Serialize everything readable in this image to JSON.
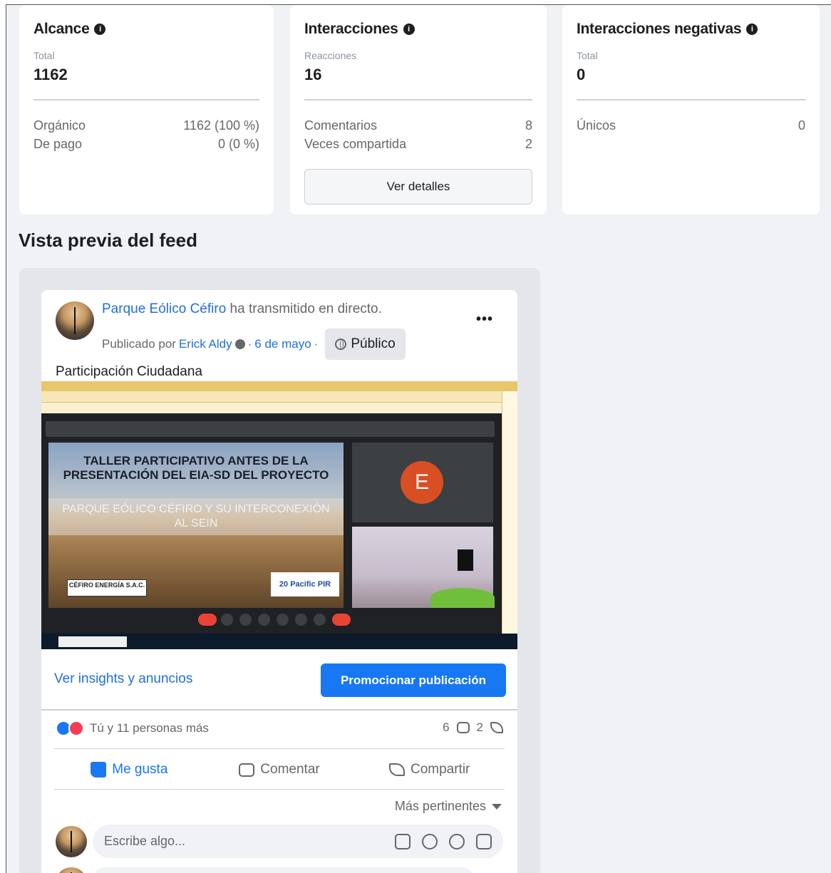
{
  "metrics": {
    "reach": {
      "title": "Alcance",
      "sub_label": "Total",
      "total": "1162",
      "rows": [
        {
          "label": "Orgánico",
          "value": "1162 (100 %)"
        },
        {
          "label": "De pago",
          "value": "0 (0 %)"
        }
      ]
    },
    "interactions": {
      "title": "Interacciones",
      "sub_label": "Reacciones",
      "total": "16",
      "rows": [
        {
          "label": "Comentarios",
          "value": "8"
        },
        {
          "label": "Veces compartida",
          "value": "2"
        }
      ],
      "details_button": "Ver detalles"
    },
    "negative": {
      "title": "Interacciones negativas",
      "sub_label": "Total",
      "total": "0",
      "rows": [
        {
          "label": "Únicos",
          "value": "0"
        }
      ]
    }
  },
  "feed_preview": {
    "section_title": "Vista previa del feed",
    "post": {
      "page_name": "Parque Eólico Céfiro",
      "action_text": "ha transmitido en directo.",
      "published_by_label": "Publicado por",
      "author": "Erick Aldy",
      "date": "6 de mayo",
      "audience": "Público",
      "text": "Participación Ciudadana",
      "media": {
        "slide_title": "TALLER PARTICIPATIVO ANTES DE LA PRESENTACIÓN DEL EIA-SD DEL PROYECTO",
        "slide_subtitle": "PARQUE EÓLICO CÉFIRO Y SU INTERCONEXIÓN AL SEIN",
        "logo_left": "CÉFIRO ENERGÍA S.A.C.",
        "logo_right": "20 Pacific PIR",
        "participant_initial": "E"
      },
      "insights_link": "Ver insights y anuncios",
      "promote_button": "Promocionar publicación",
      "reactions_text": "Tú y 11 personas más",
      "comments_count": "6",
      "shares_count": "2",
      "actions": {
        "like": "Me gusta",
        "comment": "Comentar",
        "share": "Compartir"
      },
      "sort_label": "Más pertinentes",
      "comment_placeholder": "Escribe algo..."
    }
  },
  "colors": {
    "accent": "#1877f2",
    "link": "#216fdb",
    "background": "#f0f2f5"
  }
}
